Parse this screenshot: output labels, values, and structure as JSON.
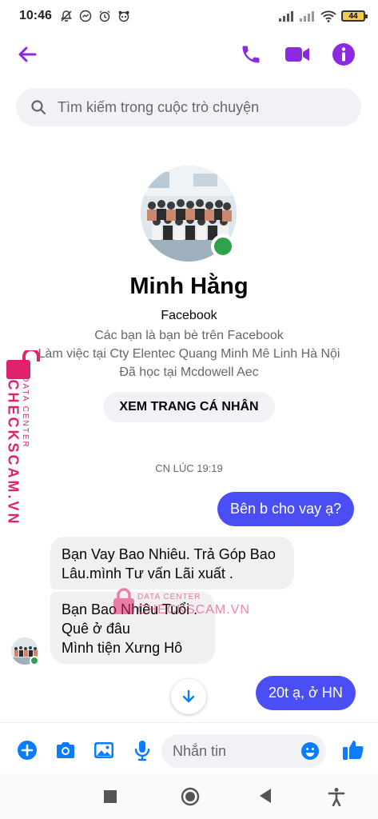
{
  "status_bar": {
    "time": "10:46",
    "battery": "44"
  },
  "header": {
    "accent": "#8a2be2"
  },
  "search": {
    "placeholder": "Tìm kiếm trong cuộc trò chuyện"
  },
  "profile": {
    "name": "Minh Hằng",
    "platform": "Facebook",
    "lines": [
      "Các bạn là bạn bè trên Facebook",
      "Làm việc tại Cty Elentec Quang Minh Mê Linh Hà Nội",
      "Đã học tại Mcdowell Aec"
    ],
    "view_profile_label": "XEM TRANG CÁ NHÂN"
  },
  "watermark": {
    "brand": "CHECKSCAM.VN",
    "tag": "DATA CENTER",
    "center_brand": "CHECKSCAM.VN"
  },
  "chat": {
    "timestamp": "CN LÚC 19:19",
    "messages": [
      {
        "from": "me",
        "text": "Bên b cho vay ạ?"
      },
      {
        "from": "them",
        "lines": [
          "Bạn Vay Bao Nhiêu. Trả Góp Bao",
          "Lâu.mình Tư vấn Lãi xuất ."
        ]
      },
      {
        "from": "them",
        "lines": [
          "Bạn Bao Nhiêu Tuổi .",
          "Quê ở đâu",
          "Mình tiện Xưng Hô"
        ]
      },
      {
        "from": "me",
        "text": "20t ạ, ở HN"
      }
    ]
  },
  "composer": {
    "placeholder": "Nhắn tin"
  },
  "colors": {
    "accent": "#8a2be2",
    "outgoing_bubble": "#4a4ef5",
    "icons": "#0a7cff",
    "online": "#31a24c"
  }
}
